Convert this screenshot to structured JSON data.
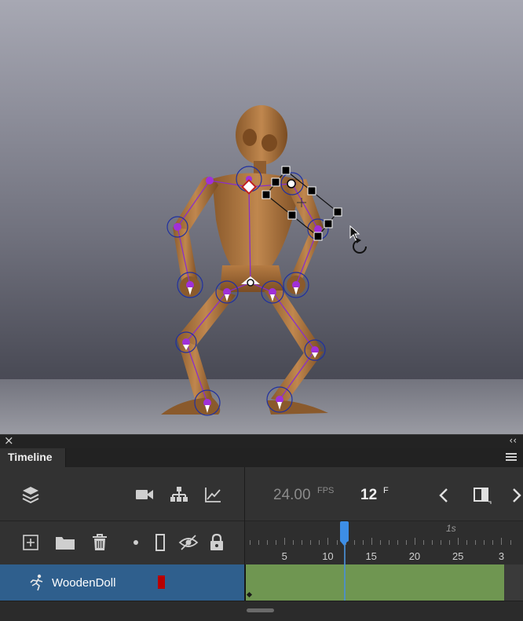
{
  "panel": {
    "close_label": "×",
    "collapse_label": "‹‹",
    "tab_title": "Timeline"
  },
  "toolbar": {
    "fps_value": "24.00",
    "fps_unit": "FPS",
    "frame_value": "12",
    "frame_unit": "F"
  },
  "ruler": {
    "labels": [
      "5",
      "10",
      "15",
      "20",
      "25",
      "3"
    ],
    "top_label": "1s"
  },
  "layer": {
    "name": "WoodenDoll",
    "color": "#b80000"
  },
  "icons": [
    "layers-icon",
    "camera-icon",
    "hierarchy-icon",
    "graph-icon",
    "prev-frame-icon",
    "onion-skin-icon",
    "next-frame-icon",
    "add-layer-icon",
    "folder-icon",
    "trash-icon",
    "dot-icon",
    "outline-icon",
    "hide-icon",
    "lock-icon",
    "armature-layer-icon"
  ],
  "colors": {
    "accent": "#3d8ee6",
    "layer_selected": "#2f5f8d",
    "frame_span": "#6f9651",
    "bone": "#9b2fd0"
  }
}
